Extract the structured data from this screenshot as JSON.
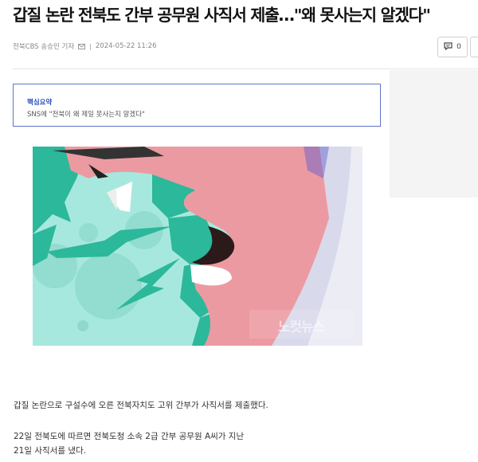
{
  "article": {
    "headline": "갑질 논란 전북도 간부 공무원 사직서 제출…\"왜 못사는지 알겠다\"",
    "byline": {
      "source_reporter": "전북CBS 송승민 기자",
      "mail_icon": "mail-icon",
      "date": "2024-05-22 11:26"
    },
    "comment": {
      "icon": "comment-icon",
      "count": "0"
    },
    "summary": {
      "title": "핵심요약",
      "text": "SNS에 \"전북이 왜 제일 못사는지 알겠다\""
    },
    "image": {
      "watermark": "노컷뉴스"
    },
    "paragraphs": [
      "갑질 논란으로 구설수에 오른 전북자치도 고위 간부가 사직서를 제출했다.",
      "22일 전북도에 따르면 전북도청 소속 2급 간부 공무원 A씨가 지난",
      "21일 사직서를 냈다."
    ]
  },
  "colors": {
    "summary_border": "#5f74c8",
    "summary_title": "#2c4db8",
    "illustration_bg": "#a7e8de",
    "illustration_teal": "#2cb89a",
    "illustration_skin": "#ec9aa1"
  }
}
